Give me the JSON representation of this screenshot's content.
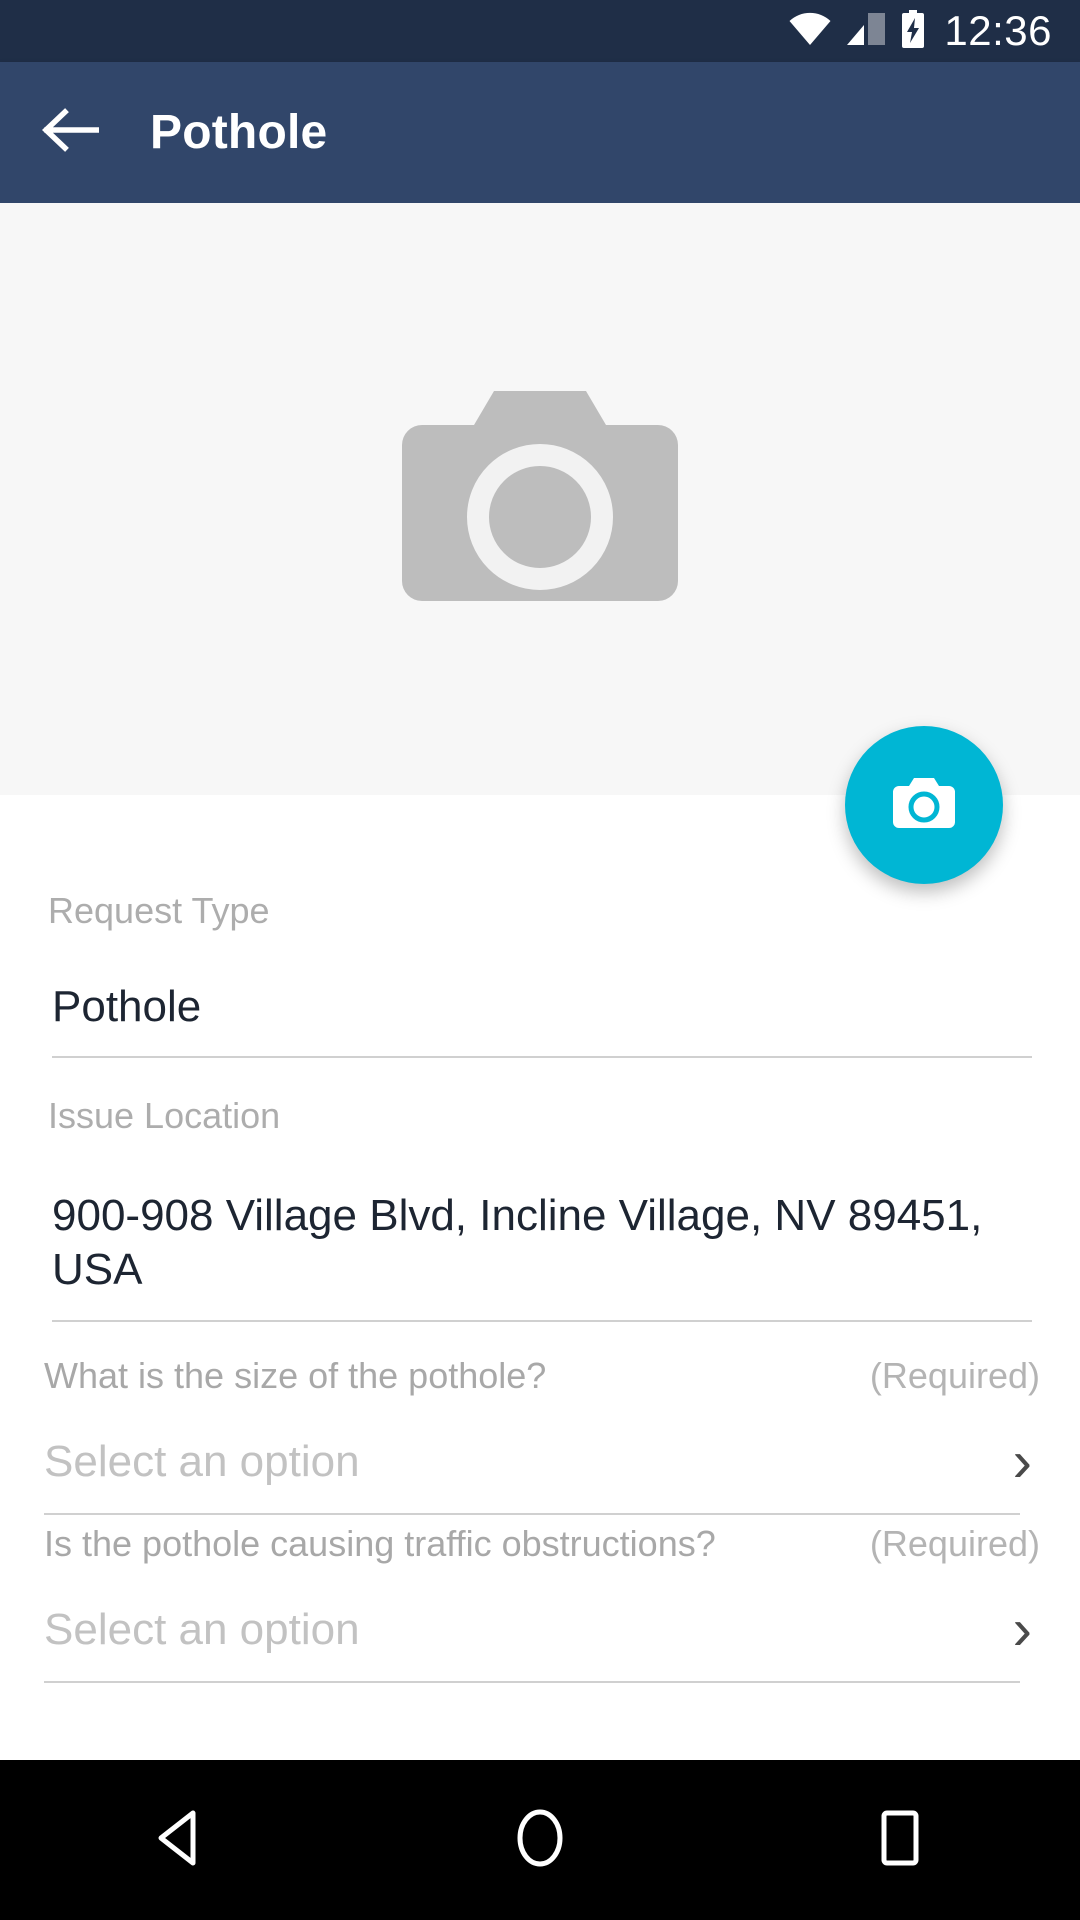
{
  "status_bar": {
    "time": "12:36",
    "icons": [
      "wifi-icon",
      "signal-icon",
      "battery-charging-icon"
    ]
  },
  "app_bar": {
    "title": "Pothole",
    "back_icon": "arrow-left-icon"
  },
  "photo_area": {
    "placeholder_icon": "camera-placeholder-icon",
    "fab_icon": "camera-icon",
    "fab_color": "#00b6d4"
  },
  "form": {
    "request_type": {
      "label": "Request Type",
      "value": "Pothole"
    },
    "issue_location": {
      "label": "Issue Location",
      "value": "900-908 Village Blvd, Incline Village, NV 89451, USA"
    },
    "questions": [
      {
        "text": "What is the size of the pothole?",
        "required_label": "(Required)",
        "placeholder": "Select an option",
        "chevron": "›"
      },
      {
        "text": "Is the pothole causing traffic obstructions?",
        "required_label": "(Required)",
        "placeholder": "Select an option",
        "chevron": "›"
      }
    ]
  },
  "nav_bar": {
    "back": "back-triangle-icon",
    "home": "home-circle-icon",
    "recents": "recents-square-icon"
  }
}
